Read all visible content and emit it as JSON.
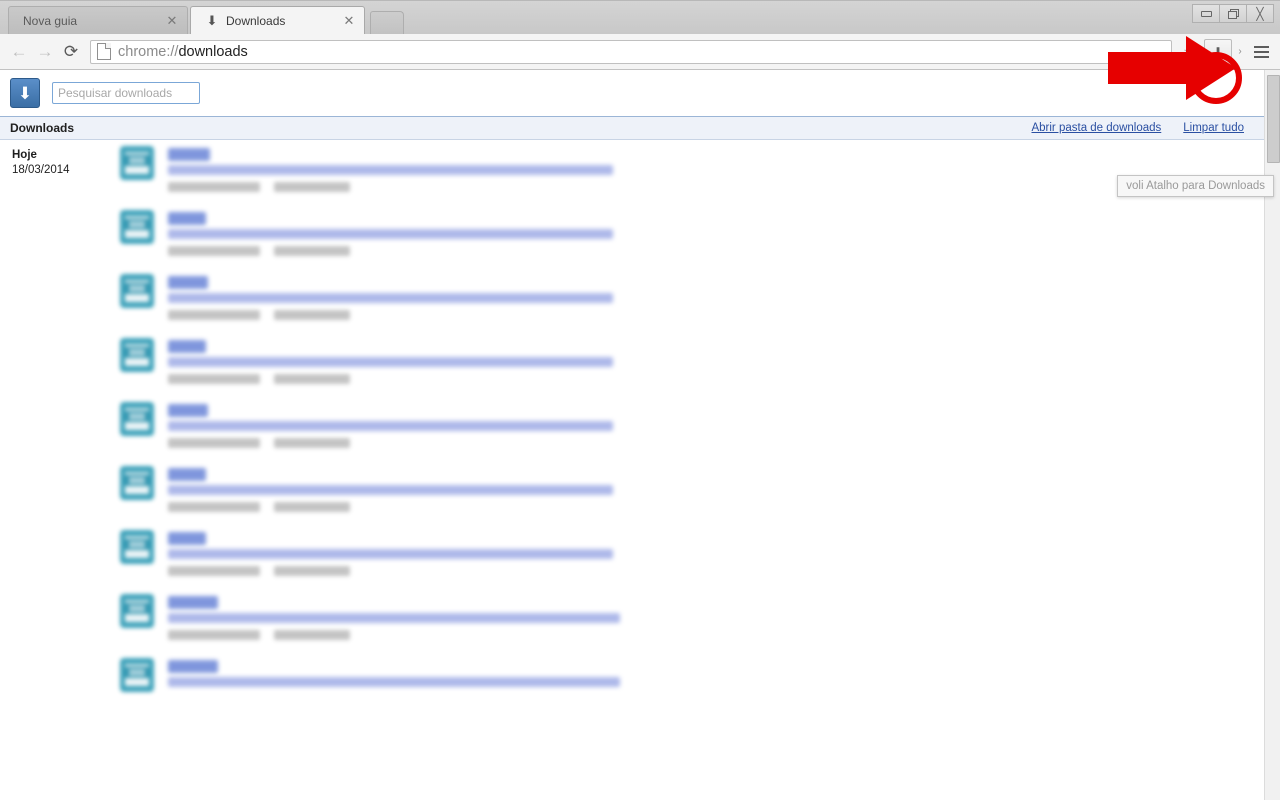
{
  "window": {
    "controls": [
      {
        "name": "minimize",
        "glyph": "minimize-icon"
      },
      {
        "name": "restore",
        "glyph": "restore-icon"
      },
      {
        "name": "close",
        "glyph": "close-icon"
      }
    ]
  },
  "tabs": [
    {
      "label": "Nova guia",
      "active": false,
      "favicon": ""
    },
    {
      "label": "Downloads",
      "active": true,
      "favicon": "download-arrow-icon"
    }
  ],
  "newtab": {
    "label": ""
  },
  "toolbar": {
    "back_label": "←",
    "forward_label": "→",
    "reload_label": "⟳",
    "omnibox": {
      "scheme": "chrome://",
      "path": "downloads",
      "full": "chrome://downloads"
    },
    "star_label": "☆",
    "downloads_button_glyph": "⬇",
    "chevron_label": "›",
    "menu_label": "menu-icon"
  },
  "tooltip": {
    "text": "voli Atalho para Downloads"
  },
  "page": {
    "search": {
      "placeholder": "Pesquisar downloads",
      "value": ""
    },
    "section": {
      "title": "Downloads",
      "links": [
        {
          "label": "Abrir pasta de downloads"
        },
        {
          "label": "Limpar tudo"
        }
      ]
    },
    "date_group": {
      "day_label": "Hoje",
      "date": "18/03/2014"
    },
    "items": [
      {
        "name_width": 42,
        "url_width": 445,
        "action_show": "",
        "action_remove": ""
      },
      {
        "name_width": 38,
        "url_width": 445,
        "action_show": "",
        "action_remove": ""
      },
      {
        "name_width": 40,
        "url_width": 445,
        "action_show": "",
        "action_remove": ""
      },
      {
        "name_width": 38,
        "url_width": 445,
        "action_show": "",
        "action_remove": ""
      },
      {
        "name_width": 40,
        "url_width": 445,
        "action_show": "",
        "action_remove": ""
      },
      {
        "name_width": 38,
        "url_width": 445,
        "action_show": "",
        "action_remove": ""
      },
      {
        "name_width": 38,
        "url_width": 445,
        "action_show": "",
        "action_remove": ""
      },
      {
        "name_width": 50,
        "url_width": 452,
        "action_show": "",
        "action_remove": ""
      },
      {
        "name_width": 50,
        "url_width": 452,
        "action_show": "",
        "action_remove": ""
      }
    ]
  },
  "annotations": {
    "arrow_color": "#e60000",
    "circle_color": "#e60000",
    "target": "downloads-toolbar-button"
  }
}
